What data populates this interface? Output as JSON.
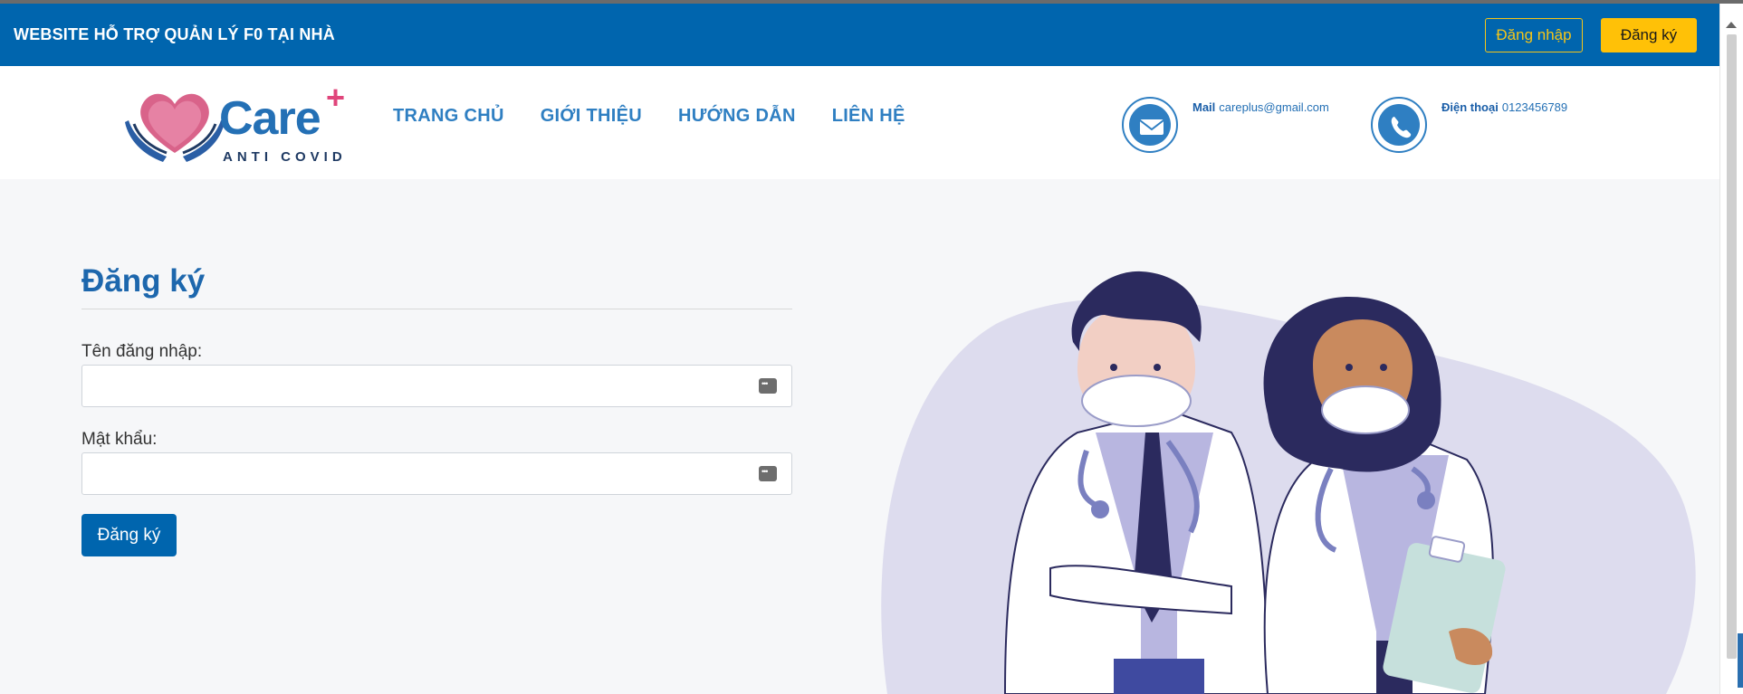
{
  "topbar": {
    "site_title": "WEBSITE HỖ TRỢ QUẢN LÝ F0 TẠI NHÀ",
    "login_label": "Đăng nhập",
    "register_label": "Đăng ký"
  },
  "header": {
    "logo": {
      "brand": "Care",
      "plus": "+",
      "sub": "ANTI COVID"
    },
    "nav": [
      "TRANG CHỦ",
      "GIỚI THIỆU",
      "HƯỚNG DẪN",
      "LIÊN HỆ"
    ],
    "contact": {
      "mail_label": "Mail",
      "mail_value": "careplus@gmail.com",
      "phone_label": "Điện thoại",
      "phone_value": "0123456789"
    }
  },
  "form": {
    "title": "Đăng ký",
    "username_label": "Tên đăng nhập:",
    "username_value": "",
    "password_label": "Mật khẩu:",
    "password_value": "",
    "submit_label": "Đăng ký"
  },
  "colors": {
    "primary": "#0065ae",
    "accent_yellow": "#ffc107",
    "nav_blue": "#2f7fc2",
    "logo_pink": "#e0457b"
  },
  "icons": [
    "mail-icon",
    "phone-icon",
    "password-manager-icon",
    "heart-hands-logo-icon"
  ]
}
